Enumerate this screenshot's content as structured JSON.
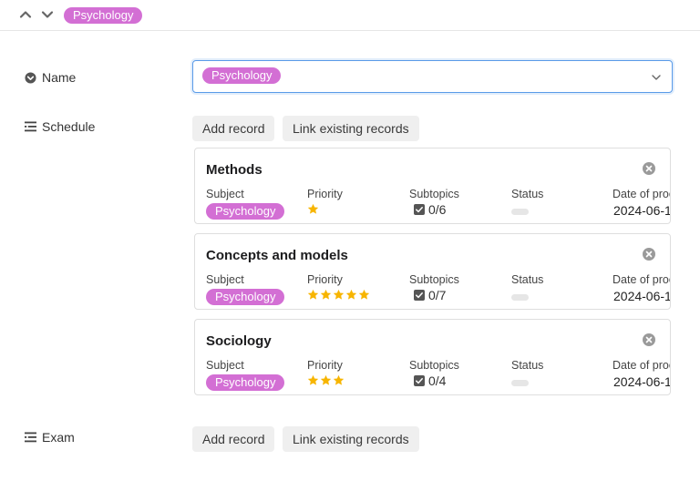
{
  "topbar": {
    "chip_label": "Psychology"
  },
  "fields": {
    "name_label": "Name",
    "name_value": "Psychology",
    "schedule_label": "Schedule",
    "exam_label": "Exam"
  },
  "buttons": {
    "add_record": "Add record",
    "link_existing": "Link existing records"
  },
  "columns": {
    "subject": "Subject",
    "priority": "Priority",
    "subtopics": "Subtopics",
    "status": "Status",
    "date": "Date of proc"
  },
  "records": [
    {
      "title": "Methods",
      "subject": "Psychology",
      "priority": 1,
      "subtopics": "0/6",
      "status": "",
      "date": "2024-06-1"
    },
    {
      "title": "Concepts and models",
      "subject": "Psychology",
      "priority": 5,
      "subtopics": "0/7",
      "status": "",
      "date": "2024-06-1"
    },
    {
      "title": "Sociology",
      "subject": "Psychology",
      "priority": 3,
      "subtopics": "0/4",
      "status": "",
      "date": "2024-06-1"
    }
  ],
  "colors": {
    "chip": "#d36fd4",
    "focus_border": "#5a9be8",
    "star": "#f7b500"
  },
  "icons": {
    "nav_up": "chevron-up-icon",
    "nav_down": "chevron-down-icon",
    "name_field": "circle-chevron-icon",
    "list_field": "list-icon",
    "close": "close-circle-icon",
    "checkbox": "checkbox-icon"
  }
}
